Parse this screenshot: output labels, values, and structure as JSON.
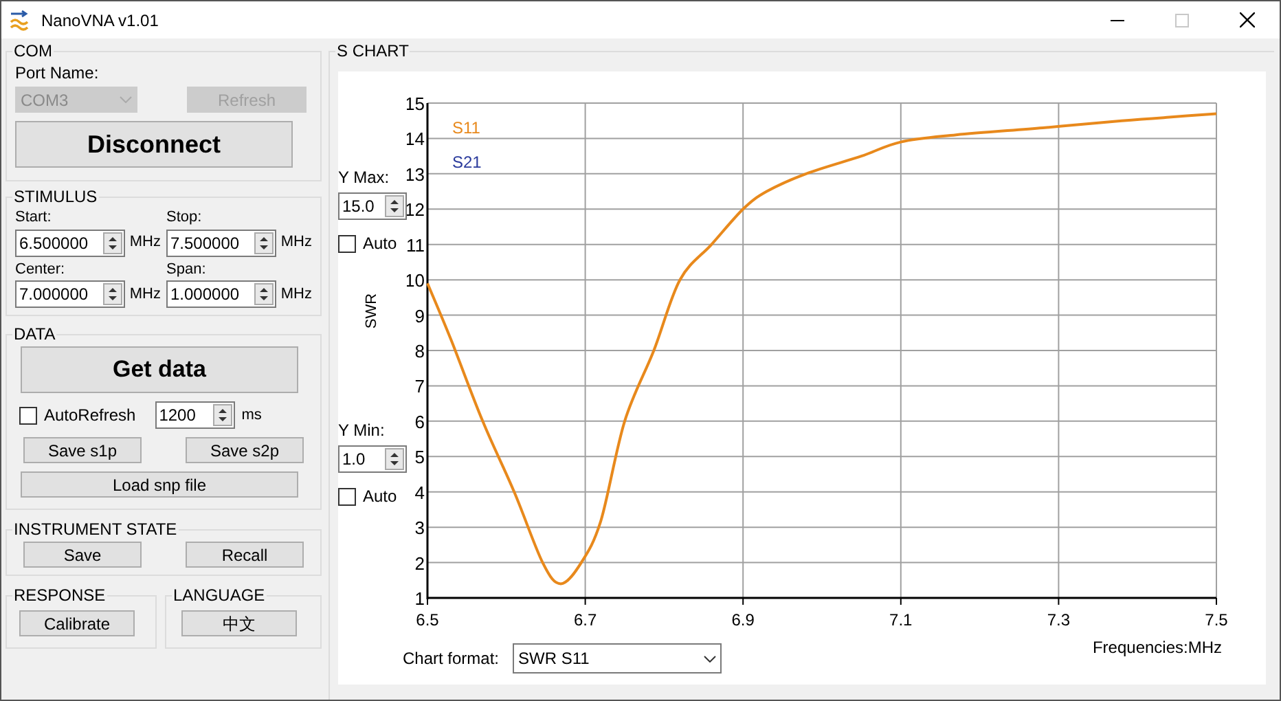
{
  "window": {
    "title": "NanoVNA v1.01",
    "maximize_disabled": true
  },
  "com": {
    "title": "COM",
    "port_label": "Port Name:",
    "port_value": "COM3",
    "port_disabled": true,
    "refresh": {
      "label": "Refresh",
      "disabled": true
    },
    "connect": {
      "label": "Disconnect",
      "disabled": false
    }
  },
  "stimulus": {
    "title": "STIMULUS",
    "fields": [
      {
        "label": "Start:",
        "value": "6.500000",
        "unit": "MHz"
      },
      {
        "label": "Stop:",
        "value": "7.500000",
        "unit": "MHz"
      },
      {
        "label": "Center:",
        "value": "7.000000",
        "unit": "MHz"
      },
      {
        "label": "Span:",
        "value": "1.000000",
        "unit": "MHz"
      }
    ]
  },
  "data": {
    "title": "DATA",
    "get": "Get data",
    "auto_refresh": {
      "label": "AutoRefresh",
      "checked": false
    },
    "interval": {
      "value": "1200",
      "unit": "ms"
    },
    "save_buttons": [
      "Save s1p",
      "Save s2p"
    ],
    "load": "Load snp file"
  },
  "instrument_state": {
    "title": "INSTRUMENT STATE",
    "buttons": [
      "Save",
      "Recall"
    ]
  },
  "response": {
    "title": "RESPONSE",
    "button": "Calibrate"
  },
  "language": {
    "title": "LANGUAGE",
    "button": "中文"
  },
  "s_chart": {
    "title": "S CHART",
    "y_max": {
      "label": "Y Max:",
      "value": "15.0",
      "auto": {
        "label": "Auto",
        "checked": false
      }
    },
    "y_min": {
      "label": "Y Min:",
      "value": "1.0",
      "auto": {
        "label": "Auto",
        "checked": false
      }
    },
    "x_unit": "Frequencies:MHz",
    "chart_format": {
      "label": "Chart format:",
      "value": "SWR S11"
    },
    "chart_data": {
      "type": "line",
      "ylabel": "SWR",
      "x": [
        6.5,
        6.53,
        6.57,
        6.61,
        6.646,
        6.669,
        6.695,
        6.72,
        6.75,
        6.787,
        6.82,
        6.86,
        6.9,
        6.93,
        6.98,
        7.05,
        7.1,
        7.17,
        7.28,
        7.38,
        7.44,
        7.5
      ],
      "series": [
        {
          "name": "S11",
          "color": "#e8891c",
          "values": [
            9.9,
            8.3,
            6,
            4,
            2,
            1.4,
            2,
            3.2,
            6,
            8,
            10,
            11,
            12,
            12.5,
            13,
            13.5,
            13.9,
            14.1,
            14.3,
            14.5,
            14.6,
            14.7
          ]
        },
        {
          "name": "S21",
          "color": "#2a3a9c",
          "values": [
            null,
            null,
            null,
            null,
            null,
            null,
            null,
            null,
            null,
            null,
            null,
            null,
            null,
            null,
            null,
            null,
            null,
            null,
            null,
            null,
            null,
            null
          ]
        }
      ],
      "grid": true,
      "xlim": [
        6.5,
        7.5
      ],
      "ylim": [
        1,
        15
      ],
      "xticks": [
        6.5,
        6.7,
        6.9,
        7.1,
        7.3,
        7.5
      ],
      "yticks": [
        1,
        2,
        3,
        4,
        5,
        6,
        7,
        8,
        9,
        10,
        11,
        12,
        13,
        14,
        15
      ]
    }
  }
}
